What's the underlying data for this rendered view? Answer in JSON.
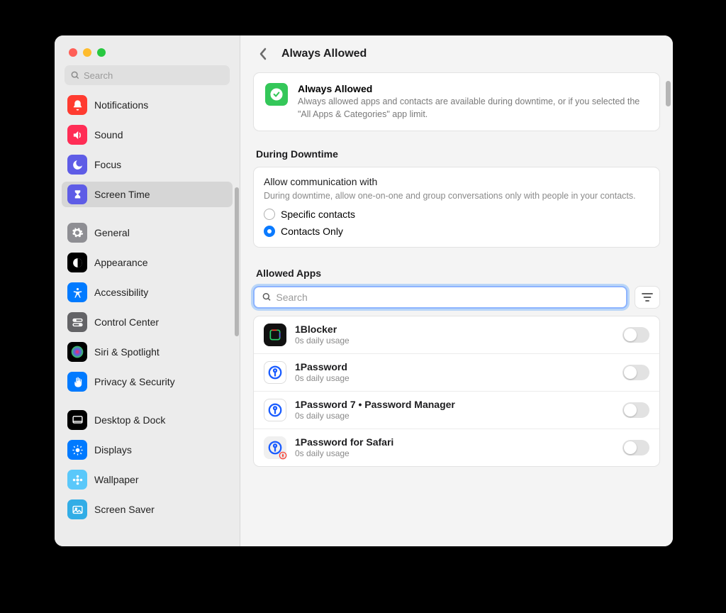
{
  "sidebar": {
    "search_placeholder": "Search",
    "items": [
      {
        "label": "Notifications",
        "icon": "bell-icon",
        "color": "bg-red"
      },
      {
        "label": "Sound",
        "icon": "speaker-icon",
        "color": "bg-pink"
      },
      {
        "label": "Focus",
        "icon": "moon-icon",
        "color": "bg-indigo"
      },
      {
        "label": "Screen Time",
        "icon": "hourglass-icon",
        "color": "bg-indigo",
        "selected": true
      },
      {
        "gap": true
      },
      {
        "label": "General",
        "icon": "gear-icon",
        "color": "bg-gray"
      },
      {
        "label": "Appearance",
        "icon": "contrast-icon",
        "color": "bg-black"
      },
      {
        "label": "Accessibility",
        "icon": "accessibility-icon",
        "color": "bg-blue"
      },
      {
        "label": "Control Center",
        "icon": "switches-icon",
        "color": "bg-darkgray"
      },
      {
        "label": "Siri & Spotlight",
        "icon": "siri-icon",
        "color": "bg-black"
      },
      {
        "label": "Privacy & Security",
        "icon": "hand-icon",
        "color": "bg-blue"
      },
      {
        "gap": true
      },
      {
        "label": "Desktop & Dock",
        "icon": "dock-icon",
        "color": "bg-black"
      },
      {
        "label": "Displays",
        "icon": "sun-icon",
        "color": "bg-blue"
      },
      {
        "label": "Wallpaper",
        "icon": "flower-icon",
        "color": "bg-teal"
      },
      {
        "label": "Screen Saver",
        "icon": "photo-icon",
        "color": "bg-cyan"
      }
    ]
  },
  "header": {
    "title": "Always Allowed"
  },
  "hero": {
    "title": "Always Allowed",
    "desc": "Always allowed apps and contacts are available during downtime, or if you selected the \"All Apps & Categories\" app limit."
  },
  "downtime": {
    "section_label": "During Downtime",
    "title": "Allow communication with",
    "desc": "During downtime, allow one-on-one and group conversations only with people in your contacts.",
    "option_specific": "Specific contacts",
    "option_contacts": "Contacts Only",
    "selected": "contacts"
  },
  "allowed_apps": {
    "section_label": "Allowed Apps",
    "search_placeholder": "Search",
    "list": [
      {
        "name": "1Blocker",
        "usage": "0s daily usage",
        "enabled": false
      },
      {
        "name": "1Password",
        "usage": "0s daily usage",
        "enabled": false
      },
      {
        "name": "1Password 7 • Password Manager",
        "usage": "0s daily usage",
        "enabled": false
      },
      {
        "name": "1Password for Safari",
        "usage": "0s daily usage",
        "enabled": false
      }
    ]
  }
}
